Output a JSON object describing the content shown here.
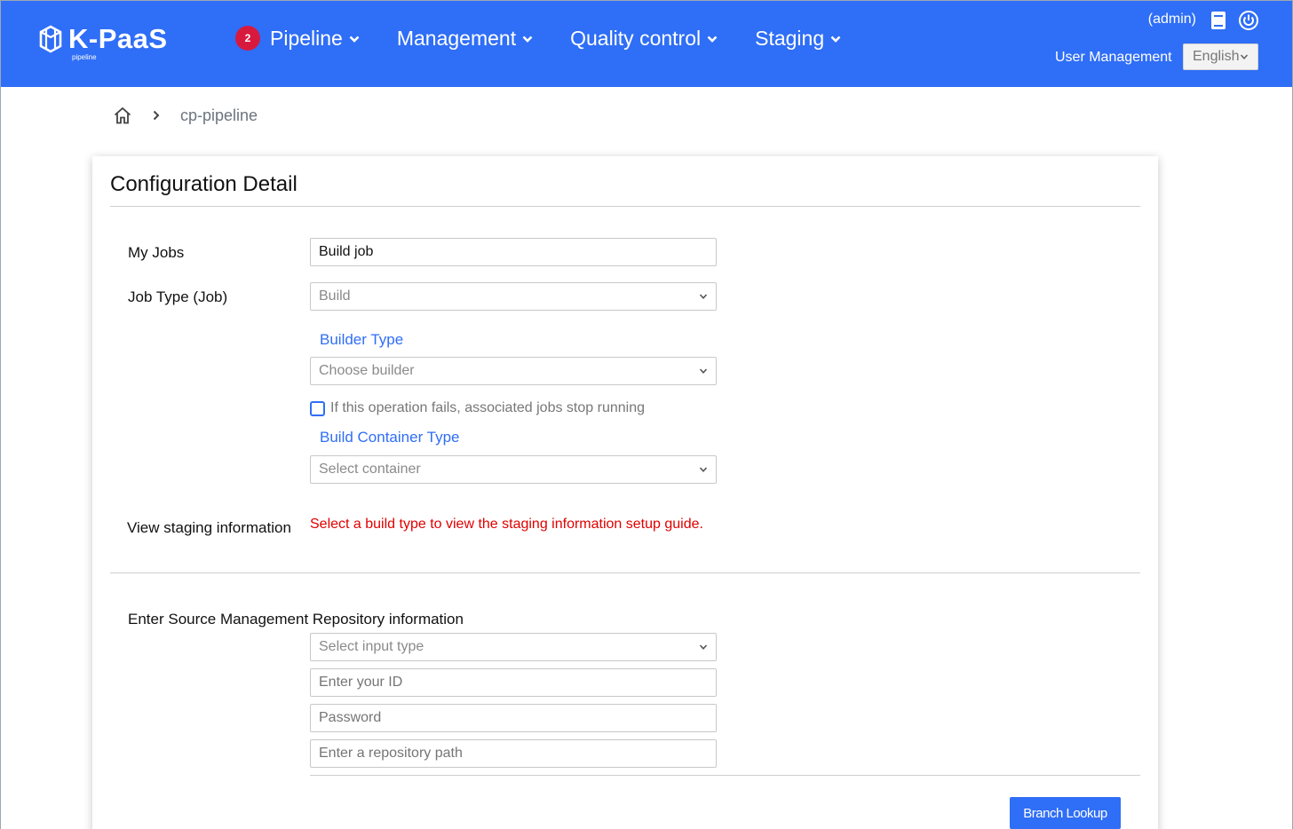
{
  "header": {
    "logo_text": "K-PaaS",
    "logo_sub": "pipeline",
    "nav": [
      {
        "label": "Pipeline",
        "badge": "2"
      },
      {
        "label": "Management"
      },
      {
        "label": "Quality control"
      },
      {
        "label": "Staging"
      }
    ],
    "user": "(admin)",
    "user_management": "User Management",
    "language": "English",
    "icons": [
      "book-icon",
      "power-icon"
    ]
  },
  "breadcrumb": {
    "current": "cp-pipeline"
  },
  "form": {
    "title": "Configuration Detail",
    "my_jobs_label": "My Jobs",
    "my_jobs_value": "Build job",
    "job_type_label": "Job Type (Job)",
    "job_type_value": "Build",
    "builder_type_label": "Builder Type",
    "builder_placeholder": "Choose builder",
    "stop_on_fail_label": "If this operation fails, associated jobs stop running",
    "stop_on_fail_checked": false,
    "container_type_label": "Build Container Type",
    "container_placeholder": "Select container",
    "staging_label": "View staging information",
    "staging_notice": "Select a build type to view the staging information setup guide.",
    "repo_label": "Enter Source Management Repository information",
    "input_type_placeholder": "Select input type",
    "id_placeholder": "Enter your ID",
    "password_placeholder": "Password",
    "repo_path_placeholder": "Enter a repository path",
    "branch_lookup": "Branch Lookup"
  },
  "colors": {
    "brand": "#2f6ef6",
    "badge": "#d8193e",
    "warning": "#e00000"
  }
}
